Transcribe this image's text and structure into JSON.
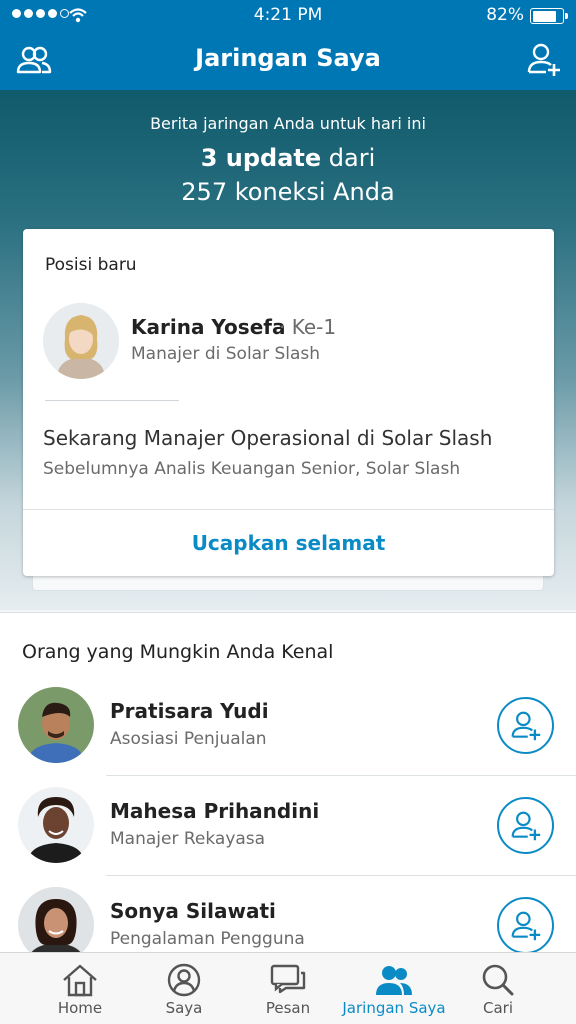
{
  "status_bar": {
    "time": "4:21 PM",
    "battery": "82%",
    "battery_level": 0.82
  },
  "nav": {
    "title": "Jaringan Saya",
    "left_icon": "connections-icon",
    "right_icon": "add-connection-icon"
  },
  "hero": {
    "line1": "Berita jaringan Anda untuk hari ini",
    "update_count": "3 update",
    "line2_rest": " dari",
    "line3": "257 koneksi Anda"
  },
  "card": {
    "label": "Posisi baru",
    "name": "Karina Yosefa",
    "degree": "· Ke-1",
    "subtitle": "Manajer di Solar Slash",
    "headline": "Sekarang Manajer Operasional di Solar Slash",
    "previous": "Sebelumnya Analis Keuangan Senior, Solar Slash",
    "action": "Ucapkan selamat"
  },
  "pymk": {
    "title": "Orang yang Mungkin Anda Kenal",
    "people": [
      {
        "name": "Pratisara Yudi",
        "role": "Asosiasi Penjualan"
      },
      {
        "name": "Mahesa Prihandini",
        "role": "Manajer Rekayasa"
      },
      {
        "name": "Sonya Silawati",
        "role": "Pengalaman Pengguna"
      }
    ]
  },
  "tabs": [
    {
      "label": "Home",
      "icon": "home-icon"
    },
    {
      "label": "Saya",
      "icon": "profile-icon"
    },
    {
      "label": "Pesan",
      "icon": "messages-icon"
    },
    {
      "label": "Jaringan Saya",
      "icon": "network-icon",
      "active": true
    },
    {
      "label": "Cari",
      "icon": "search-icon"
    }
  ],
  "colors": {
    "brand": "#0077b5",
    "accent": "#0b8bc6"
  }
}
